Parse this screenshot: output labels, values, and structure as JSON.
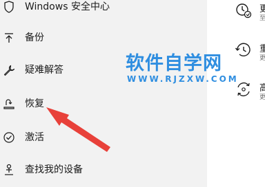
{
  "sidebar": {
    "header": "Windows 安全中心",
    "items": [
      {
        "label": "备份",
        "icon": "upload-arrow-icon"
      },
      {
        "label": "疑难解答",
        "icon": "wrench-icon"
      },
      {
        "label": "恢复",
        "icon": "recovery-icon"
      },
      {
        "label": "激活",
        "icon": "check-circle-icon"
      },
      {
        "label": "查找我的设备",
        "icon": "person-locate-icon"
      }
    ]
  },
  "content": {
    "options": [
      {
        "icon": "history-clock-icon",
        "title": "更",
        "subtitle": "至"
      },
      {
        "icon": "history-icon",
        "title": "重",
        "subtitle": "更"
      },
      {
        "icon": "sync-gear-icon",
        "title": "高",
        "subtitle": "更"
      }
    ]
  },
  "watermark": {
    "main": "软件自学网",
    "sub": "WWW.RJZXW.COM",
    "color": "#2f8ee0"
  },
  "annotation": {
    "arrow_color": "#e8413a"
  }
}
